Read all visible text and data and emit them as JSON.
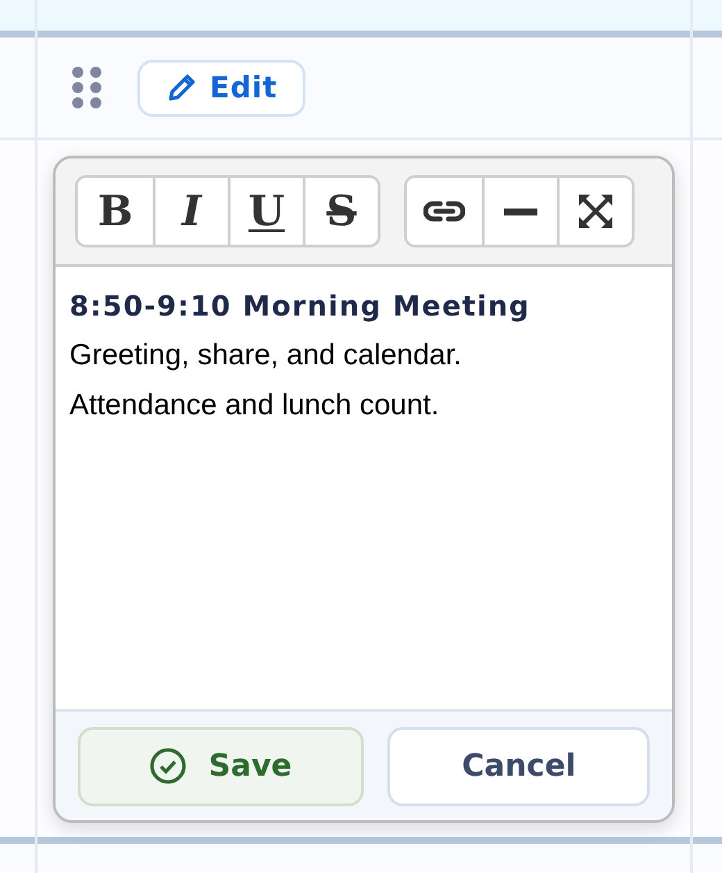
{
  "row": {
    "edit_button": "Edit"
  },
  "editor": {
    "toolbar": [
      [
        {
          "kind": "bold",
          "label": "B"
        },
        {
          "kind": "italic",
          "label": "I"
        },
        {
          "kind": "underline",
          "label": "U"
        },
        {
          "kind": "strike",
          "label": "S"
        }
      ],
      [
        {
          "kind": "link"
        },
        {
          "kind": "rule"
        },
        {
          "kind": "fullscreen"
        }
      ]
    ],
    "heading": "8:50-9:10 Morning Meeting",
    "lines": [
      "Greeting, share, and calendar.",
      "Attendance and lunch count."
    ]
  },
  "actions": {
    "save": "Save",
    "cancel": "Cancel"
  }
}
